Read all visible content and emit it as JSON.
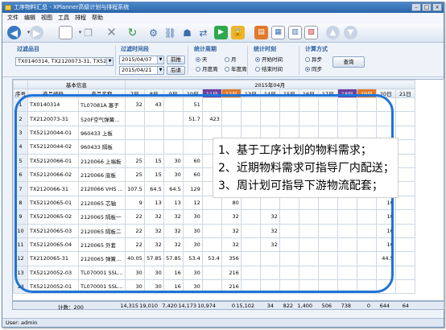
{
  "window": {
    "title": "工序物料汇总 - XPlanner高级计划与排程系统"
  },
  "menu": [
    "文件",
    "编辑",
    "视图",
    "工具",
    "排程",
    "帮助"
  ],
  "side_tab": "汇总",
  "filters": {
    "item": {
      "title": "过滤品目",
      "value": "TX0140314, TX2120073-31, TX52..."
    },
    "time": {
      "title": "过滤时间段",
      "from": "2015/04/07",
      "to": "2015/04/21",
      "prev": "前推",
      "next": "后退"
    },
    "period": {
      "title": "统计周期",
      "options": [
        "天",
        "月",
        "月度周",
        "年度周"
      ],
      "selected": "天"
    },
    "timing": {
      "title": "统计时刻",
      "options": [
        "开始时间",
        "结束时间"
      ],
      "selected": "开始时间"
    },
    "calc": {
      "title": "计算方式",
      "options": [
        "异步",
        "同步"
      ],
      "selected": "同步"
    },
    "query_label": "查询"
  },
  "grid": {
    "group_basic": "基本信息",
    "month": "2015年04月",
    "col_seq": "序号",
    "col_code": "产品编码",
    "col_name": "产品名称",
    "days": [
      "7日",
      "8日",
      "9日",
      "10日",
      "11日",
      "12日",
      "13日",
      "14日",
      "15日",
      "16日",
      "17日",
      "18日",
      "19日",
      "20日",
      "21日"
    ],
    "rows": [
      {
        "seq": "1",
        "code": "TX0140314",
        "name": "TL07081A 塞子",
        "vals": [
          "32",
          "43",
          "",
          "51",
          "",
          "",
          "",
          "",
          "",
          "",
          "",
          "",
          "",
          "",
          ""
        ]
      },
      {
        "seq": "2",
        "code": "TX2120073-31",
        "name": "520F空气弹簧...",
        "vals": [
          "",
          "",
          "",
          "51.7",
          "423",
          "",
          "",
          "",
          "",
          "",
          "",
          "",
          "",
          "",
          ""
        ]
      },
      {
        "seq": "3",
        "code": "TX52120044-01",
        "name": "960433 上板",
        "vals": [
          "",
          "",
          "",
          "",
          "",
          "",
          "",
          "",
          "",
          "",
          "",
          "",
          "",
          "",
          ""
        ]
      },
      {
        "seq": "4",
        "code": "TX52120044-02",
        "name": "960433 隔板",
        "vals": [
          "",
          "",
          "",
          "",
          "",
          "",
          "",
          "",
          "",
          "",
          "",
          "",
          "",
          "",
          ""
        ]
      },
      {
        "seq": "5",
        "code": "TX52120066-01",
        "name": "2120066 上端板",
        "vals": [
          "25",
          "15",
          "30",
          "60",
          "",
          "",
          "",
          "",
          "",
          "",
          "",
          "",
          "",
          "",
          ""
        ]
      },
      {
        "seq": "6",
        "code": "TX52120066-02",
        "name": "2120066 底板",
        "vals": [
          "25",
          "15",
          "30",
          "60",
          "",
          "",
          "",
          "",
          "",
          "",
          "",
          "",
          "",
          "",
          ""
        ]
      },
      {
        "seq": "7",
        "code": "TX2120066-31",
        "name": "2120066 VHS ...",
        "vals": [
          "107.5",
          "64.5",
          "64.5",
          "129",
          "",
          "",
          "",
          "",
          "",
          "",
          "",
          "",
          "",
          "",
          ""
        ]
      },
      {
        "seq": "8",
        "code": "TX52120065-01",
        "name": "2120065 芯轴",
        "vals": [
          "9",
          "13",
          "13",
          "12",
          "",
          "80",
          "",
          "",
          "",
          "",
          "",
          "",
          "",
          "10",
          ""
        ]
      },
      {
        "seq": "9",
        "code": "TX52120065-02",
        "name": "2120065 隔板一",
        "vals": [
          "22",
          "32",
          "32",
          "30",
          "",
          "32",
          "",
          "32",
          "",
          "",
          "",
          "",
          "",
          "10",
          ""
        ]
      },
      {
        "seq": "10",
        "code": "TX52120065-03",
        "name": "2120065 隔板二",
        "vals": [
          "22",
          "32",
          "32",
          "30",
          "",
          "32",
          "",
          "32",
          "",
          "",
          "",
          "",
          "",
          "10",
          ""
        ]
      },
      {
        "seq": "11",
        "code": "TX52120065-04",
        "name": "2120065 外套",
        "vals": [
          "22",
          "32",
          "32",
          "30",
          "",
          "32",
          "",
          "32",
          "",
          "",
          "",
          "",
          "",
          "10",
          ""
        ]
      },
      {
        "seq": "12",
        "code": "TX2120065-31",
        "name": "2120065 弹簧...",
        "vals": [
          "40.05",
          "57.85",
          "57.85",
          "53.4",
          "53.4",
          "356",
          "",
          "",
          "",
          "",
          "",
          "",
          "",
          "44.5",
          ""
        ]
      },
      {
        "seq": "13",
        "code": "TX52120052-03",
        "name": "TL070001 SSL...",
        "vals": [
          "30",
          "30",
          "16",
          "30",
          "",
          "216",
          "",
          "",
          "",
          "",
          "",
          "",
          "",
          "",
          ""
        ]
      },
      {
        "seq": "14",
        "code": "TX52120052-01",
        "name": "TL070001 SSL...",
        "vals": [
          "30",
          "30",
          "16",
          "30",
          "",
          "216",
          "",
          "",
          "",
          "",
          "",
          "",
          "",
          "",
          ""
        ]
      }
    ],
    "summary_label": "计数：200",
    "totals": [
      "14,315",
      "19,010",
      "7,420",
      "14,173",
      "10,974",
      "0",
      "15,102",
      "34",
      "822",
      "1,400",
      "506",
      "738",
      "0",
      "644",
      "64"
    ]
  },
  "callout": {
    "lines": [
      "1、基于工序计划的物料需求；",
      "2、近期物料需求可指导厂内配送；",
      "3、周计划可指导下游物流配套；"
    ],
    "color": "#1f74d6"
  },
  "status": {
    "user": "User: admin"
  }
}
